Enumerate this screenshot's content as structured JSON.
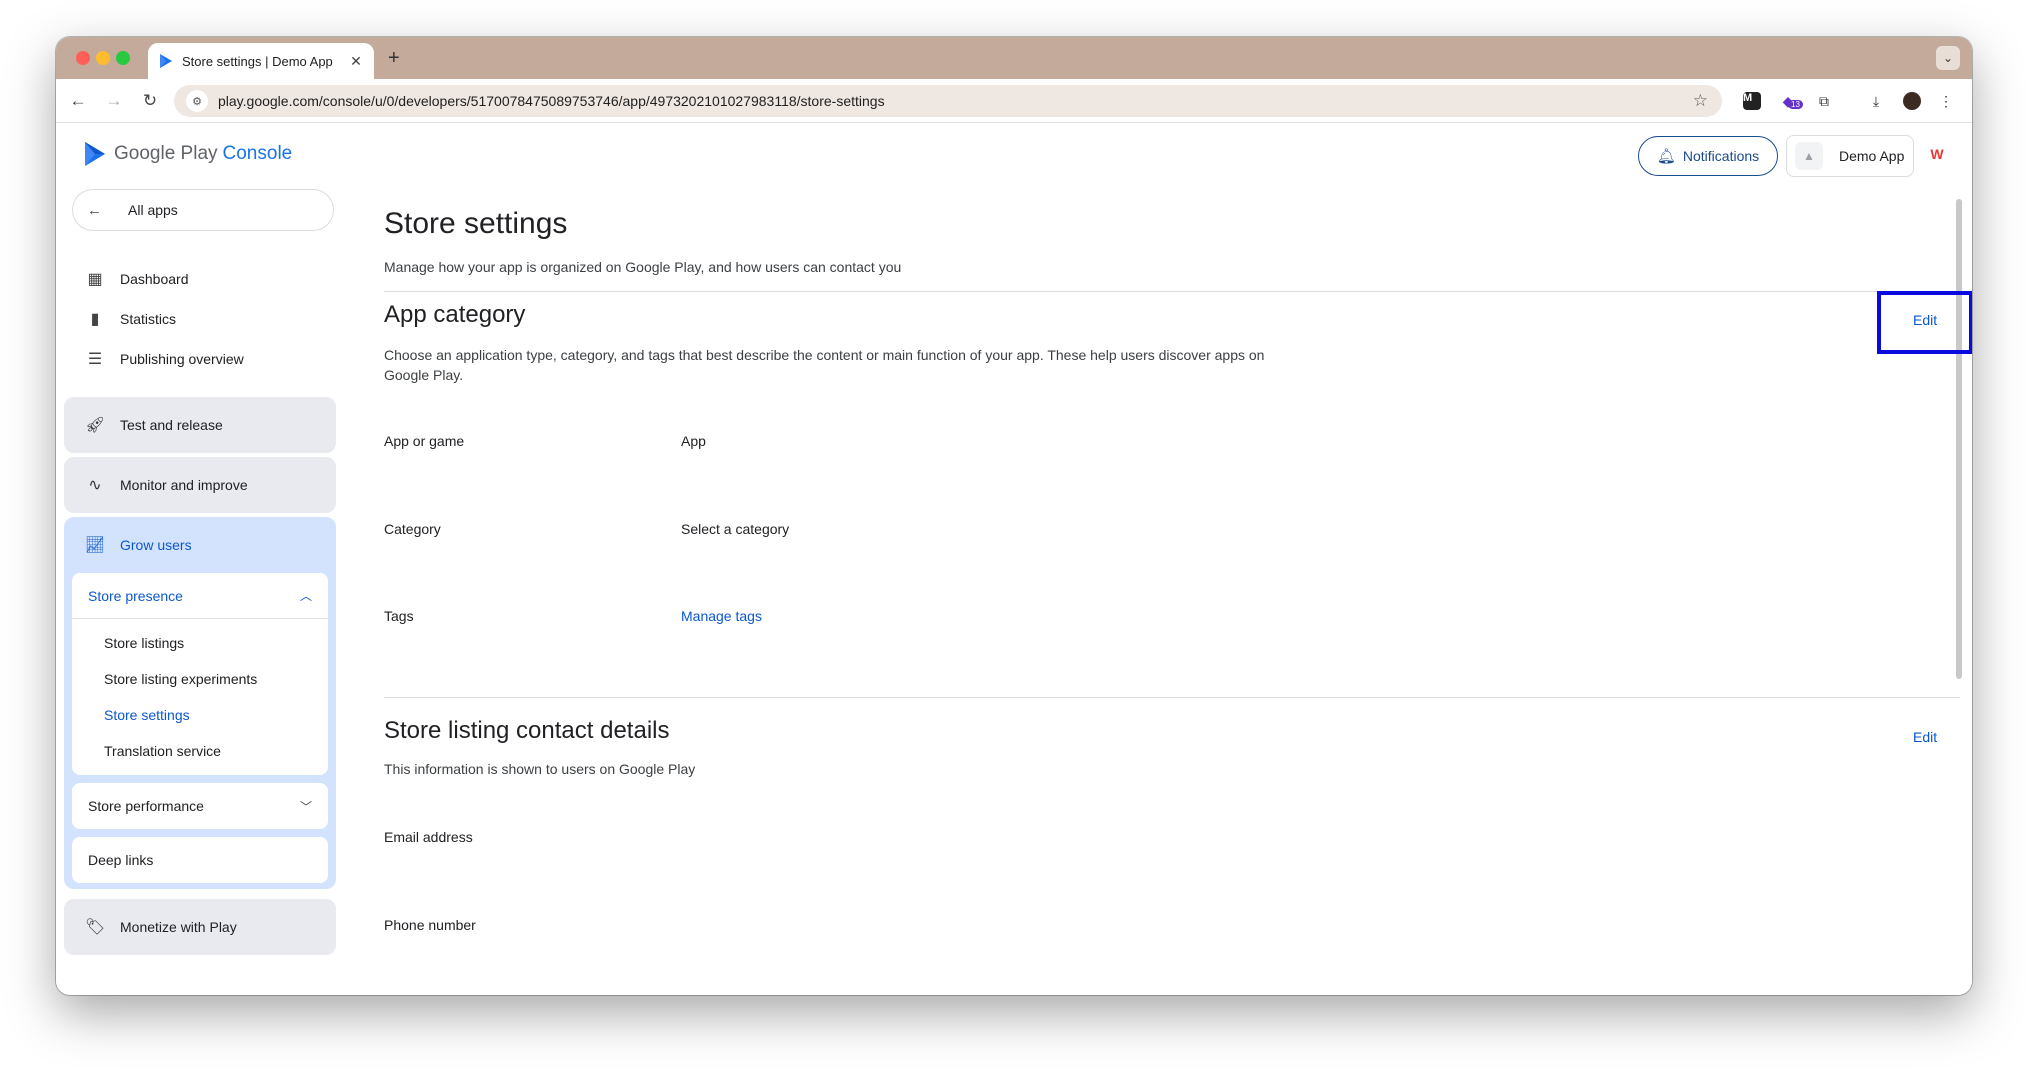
{
  "browser": {
    "tab_title": "Store settings | Demo App",
    "url": "play.google.com/console/u/0/developers/5170078475089753746/app/4973202101027983118/store-settings",
    "extension_badge": "13"
  },
  "header": {
    "logo_text": "Google Play",
    "logo_console": "Console",
    "notifications_label": "Notifications",
    "app_name": "Demo App"
  },
  "sidebar": {
    "all_apps": "All apps",
    "items": [
      {
        "label": "Dashboard",
        "icon": "dashboard-icon"
      },
      {
        "label": "Statistics",
        "icon": "bar-chart-icon"
      },
      {
        "label": "Publishing overview",
        "icon": "publishing-overview-icon"
      }
    ],
    "groups": {
      "test_release": "Test and release",
      "monitor": "Monitor and improve",
      "grow": "Grow users",
      "monetize": "Monetize with Play"
    },
    "store_presence": {
      "label": "Store presence",
      "items": [
        "Store listings",
        "Store listing experiments",
        "Store settings",
        "Translation service"
      ]
    },
    "store_performance": "Store performance",
    "deep_links": "Deep links"
  },
  "main": {
    "title": "Store settings",
    "subtitle": "Manage how your app is organized on Google Play, and how users can contact you",
    "app_category": {
      "title": "App category",
      "description": "Choose an application type, category, and tags that best describe the content or main function of your app. These help users discover apps on Google Play.",
      "edit": "Edit",
      "fields": [
        {
          "label": "App or game",
          "value": "App"
        },
        {
          "label": "Category",
          "value": "Select a category"
        },
        {
          "label": "Tags",
          "value": "Manage tags"
        }
      ]
    },
    "contact": {
      "title": "Store listing contact details",
      "description": "This information is shown to users on Google Play",
      "edit": "Edit",
      "fields": [
        {
          "label": "Email address"
        },
        {
          "label": "Phone number"
        }
      ]
    }
  },
  "colors": {
    "accent": "#0b57d0",
    "highlight_box": "#0a0ae0",
    "tabstrip": "#c3aa9a"
  }
}
